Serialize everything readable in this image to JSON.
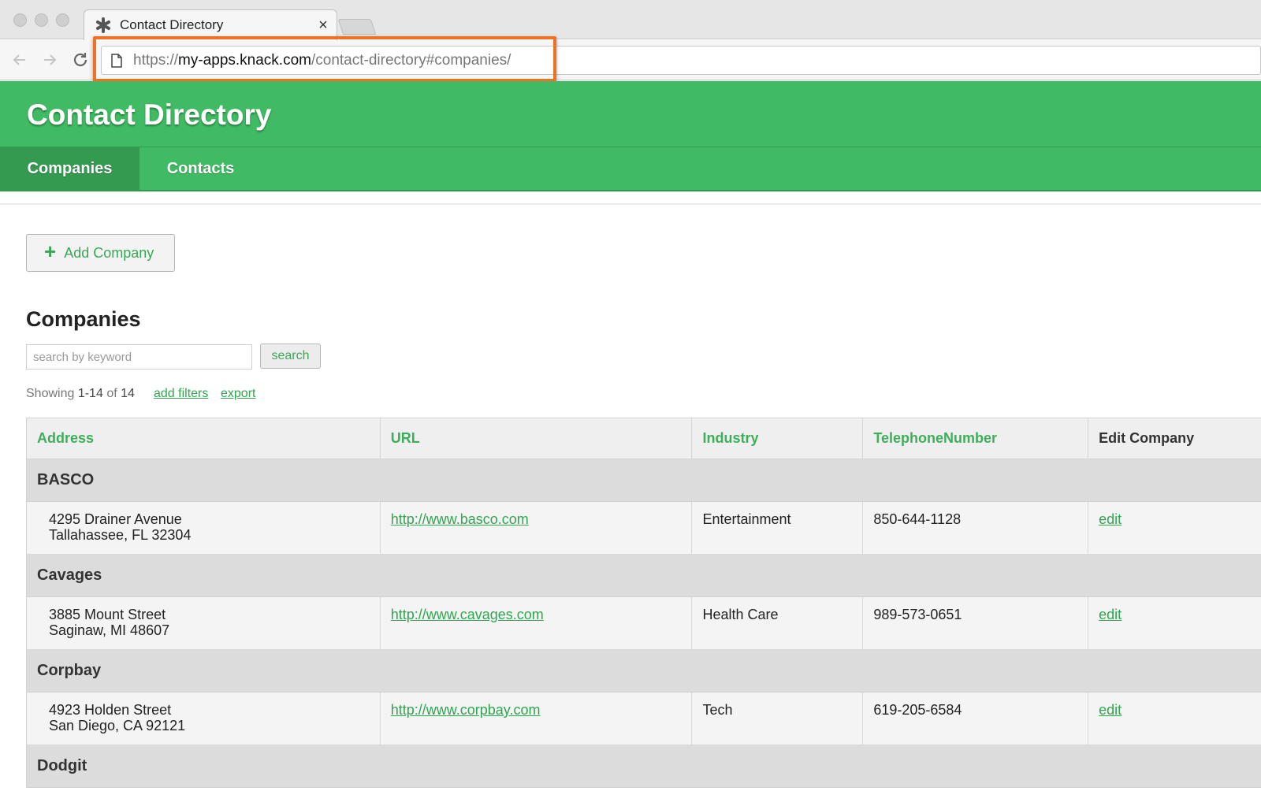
{
  "browser": {
    "tab_title": "Contact Directory",
    "tab_close": "×",
    "url_scheme": "https://",
    "url_host": "my-apps.knack.com",
    "url_path": "/contact-directory#companies/"
  },
  "app": {
    "title": "Contact Directory",
    "nav": [
      {
        "label": "Companies",
        "active": true
      },
      {
        "label": "Contacts",
        "active": false
      }
    ]
  },
  "main": {
    "add_button_label": "Add Company",
    "section_title": "Companies",
    "search": {
      "placeholder": "search by keyword",
      "value": "",
      "button_label": "search"
    },
    "showing": {
      "prefix": "Showing",
      "range": "1-14",
      "of": "of",
      "total": "14"
    },
    "links": {
      "add_filters": "add filters",
      "export": "export"
    }
  },
  "table": {
    "columns": [
      "Address",
      "URL",
      "Industry",
      "TelephoneNumber",
      "Edit Company"
    ],
    "groups": [
      {
        "name": "BASCO",
        "row": {
          "address_line1": "4295 Drainer Avenue",
          "address_line2": "Tallahassee, FL 32304",
          "url": "http://www.basco.com",
          "industry": "Entertainment",
          "phone": "850-644-1128",
          "edit": "edit"
        }
      },
      {
        "name": "Cavages",
        "row": {
          "address_line1": "3885 Mount Street",
          "address_line2": "Saginaw, MI 48607",
          "url": "http://www.cavages.com",
          "industry": "Health Care",
          "phone": "989-573-0651",
          "edit": "edit"
        }
      },
      {
        "name": "Corpbay",
        "row": {
          "address_line1": "4923 Holden Street",
          "address_line2": "San Diego, CA 92121",
          "url": "http://www.corpbay.com",
          "industry": "Tech",
          "phone": "619-205-6584",
          "edit": "edit"
        }
      },
      {
        "name": "Dodgit"
      }
    ]
  },
  "colors": {
    "brand_green": "#40bb63",
    "active_nav": "#339a50",
    "link_green": "#2fa64f",
    "highlight_orange": "#ee7223"
  },
  "icons": {
    "favicon": "knack-asterisk-icon",
    "back": "arrow-left-icon",
    "forward": "arrow-right-icon",
    "reload": "reload-icon",
    "page": "page-icon",
    "add": "plus-icon"
  }
}
